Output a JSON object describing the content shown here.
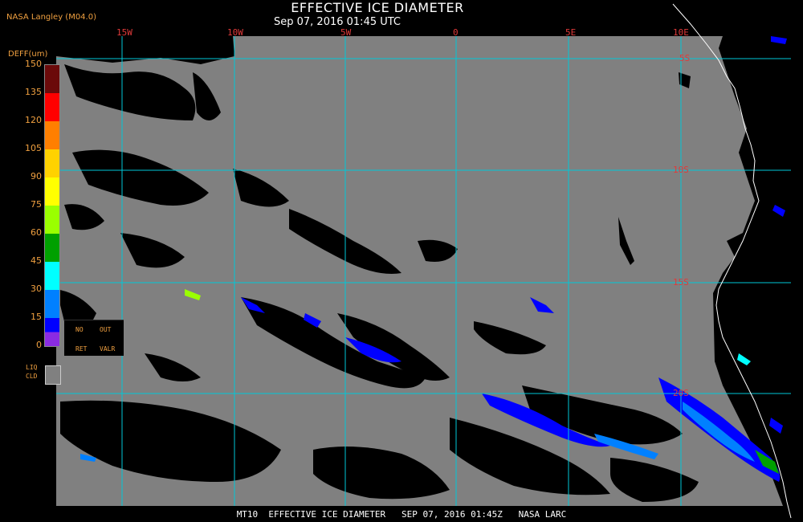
{
  "header": {
    "title": "EFFECTIVE ICE DIAMETER",
    "subtitle": "Sep 07, 2016 01:45 UTC",
    "producer": "NASA Langley (M04.0)"
  },
  "map": {
    "longitude_labels": [
      "15W",
      "10W",
      "5W",
      "0",
      "5E",
      "10E"
    ],
    "latitude_labels": [
      "5S",
      "10S",
      "15S",
      "20S"
    ],
    "colors": {
      "clear": "#000000",
      "liquid_cloud": "#808080",
      "grid": "#00c8d8",
      "coastline": "#ffffff",
      "label": "#e03a3a"
    }
  },
  "legend": {
    "title": "DEFF(um)",
    "ticks": [
      "150",
      "135",
      "120",
      "105",
      "90",
      "75",
      "60",
      "45",
      "30",
      "15",
      "0"
    ],
    "colors": [
      "#6b0a0a",
      "#ff0000",
      "#ff7f00",
      "#ffd200",
      "#ffff00",
      "#9aff00",
      "#00a000",
      "#00ffff",
      "#0080ff",
      "#0000ff",
      "#8a2be2"
    ],
    "no_ret": {
      "line1a": "NO",
      "line1b": "OUT",
      "line2a": "RET",
      "line2b": "VALR"
    },
    "liq_cld": {
      "line1": "LIQ",
      "line2": "CLD"
    }
  },
  "footer": {
    "text": "MT10  EFFECTIVE ICE DIAMETER   SEP 07, 2016 01:45Z   NASA LARC"
  }
}
